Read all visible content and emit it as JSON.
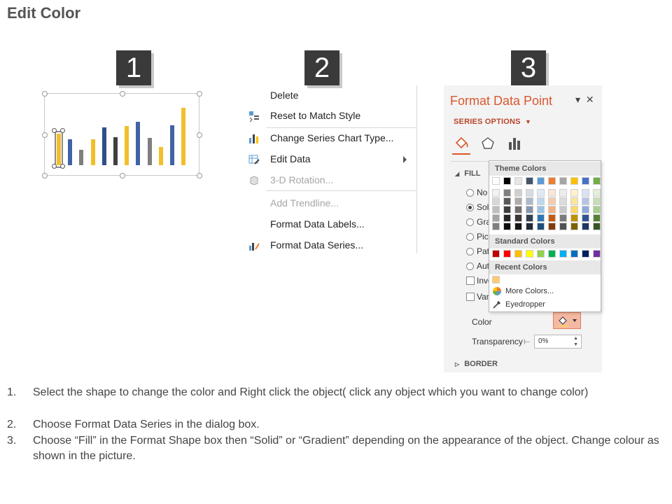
{
  "page": {
    "title": "Edit Color"
  },
  "steps": [
    "1",
    "2",
    "3"
  ],
  "mini_chart": {
    "bars": [
      {
        "value": 45,
        "color": "#f2bf2a"
      },
      {
        "value": 37,
        "color": "#3f63a6"
      },
      {
        "value": 22,
        "color": "#7f7f7f"
      },
      {
        "value": 37,
        "color": "#f2bf2a"
      },
      {
        "value": 54,
        "color": "#2f4f8a"
      },
      {
        "value": 40,
        "color": "#404040"
      },
      {
        "value": 56,
        "color": "#f2bf2a"
      },
      {
        "value": 62,
        "color": "#3f63a6"
      },
      {
        "value": 39,
        "color": "#7f7f7f"
      },
      {
        "value": 26,
        "color": "#f2bf2a"
      },
      {
        "value": 57,
        "color": "#3f63a6"
      },
      {
        "value": 82,
        "color": "#f2bf2a"
      }
    ],
    "selected_index": 0
  },
  "context_menu": {
    "items": [
      {
        "label": "Delete",
        "icon": "delete-icon",
        "disabled": false
      },
      {
        "label": "Reset to Match Style",
        "icon": "reset-style-icon",
        "disabled": false
      },
      {
        "label": "Change Series Chart Type...",
        "icon": "chart-type-icon",
        "disabled": false
      },
      {
        "label": "Edit Data",
        "icon": "edit-data-icon",
        "disabled": false,
        "submenu": true
      },
      {
        "label": "3-D Rotation...",
        "icon": "3d-rotation-icon",
        "disabled": true
      },
      {
        "label": "Add Trendline...",
        "icon": "",
        "disabled": true
      },
      {
        "label": "Format Data Labels...",
        "icon": "",
        "disabled": false
      },
      {
        "label": "Format Data Series...",
        "icon": "format-series-icon",
        "disabled": false
      }
    ]
  },
  "format_pane": {
    "title": "Format Data Point",
    "series_options": "SERIES OPTIONS",
    "fill_section": "FILL",
    "fill_options": [
      "No",
      "Soli",
      "Gra",
      "Pict",
      "Patt",
      "Aut"
    ],
    "selected_fill": 1,
    "checkboxes": [
      "Inve",
      "Var"
    ],
    "color_label": "Color",
    "transparency_label": "Transparency",
    "transparency_value": "0%",
    "border_section": "BORDER",
    "accent_color": "#d9572d"
  },
  "color_popup": {
    "theme_colors_label": "Theme Colors",
    "standard_colors_label": "Standard Colors",
    "recent_colors_label": "Recent Colors",
    "more_colors": "More Colors...",
    "eyedropper": "Eyedropper",
    "theme_top": [
      "#ffffff",
      "#000000",
      "#e7e6e6",
      "#44546a",
      "#5b9bd5",
      "#ed7d31",
      "#a5a5a5",
      "#ffc000",
      "#4472c4",
      "#70ad47"
    ],
    "theme_shades": [
      [
        "#f2f2f2",
        "#7f7f7f",
        "#d0cece",
        "#d6dce4",
        "#deebf6",
        "#fbe5d5",
        "#ededed",
        "#fff2cc",
        "#dae3f3",
        "#e2efd9"
      ],
      [
        "#d8d8d8",
        "#595959",
        "#aeabab",
        "#adb9ca",
        "#bdd7ee",
        "#f7cbac",
        "#dbdbdb",
        "#fee599",
        "#b4c6e7",
        "#c5e0b3"
      ],
      [
        "#bfbfbf",
        "#3f3f3f",
        "#757070",
        "#8496b0",
        "#9cc3e5",
        "#f4b183",
        "#c9c9c9",
        "#ffd965",
        "#8eaadb",
        "#a8d08d"
      ],
      [
        "#a5a5a5",
        "#262626",
        "#3a3838",
        "#323f4f",
        "#2e75b5",
        "#c55a11",
        "#7b7b7b",
        "#bf9000",
        "#2f5496",
        "#538135"
      ],
      [
        "#7f7f7f",
        "#0c0c0c",
        "#171616",
        "#222a35",
        "#1e4e79",
        "#843c0b",
        "#525252",
        "#7f6000",
        "#1f3864",
        "#375623"
      ]
    ],
    "standard": [
      "#c00000",
      "#ff0000",
      "#ffc000",
      "#ffff00",
      "#92d050",
      "#00b050",
      "#00b0f0",
      "#0070c0",
      "#002060",
      "#7030a0"
    ],
    "recent": [
      "#ffc970"
    ]
  },
  "instructions": [
    {
      "num": "1.",
      "text": "Select the shape to change the color and Right click the object( click any object which you want to change color)"
    },
    {
      "num": "2.",
      "text": "Choose Format Data Series in the dialog box."
    },
    {
      "num": "3.",
      "text": "Choose “Fill” in the Format Shape box then “Solid” or “Gradient” depending on the appearance of the object. Change colour as shown in the picture."
    }
  ]
}
